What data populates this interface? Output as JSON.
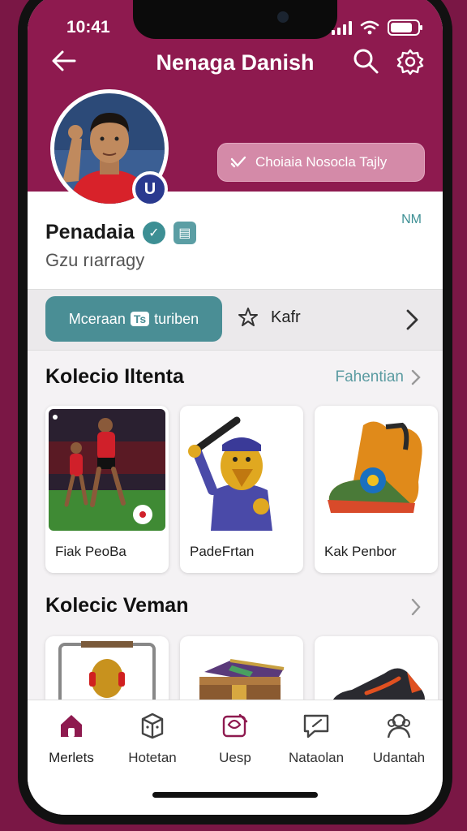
{
  "status": {
    "time": "10:41"
  },
  "header": {
    "title": "Nenaga Danish",
    "action_button": "Choiaia Nosocla Tajly"
  },
  "profile": {
    "name": "Penadaia",
    "subtitle": "Gzu rıarragy",
    "corner_tag": "NM"
  },
  "tabs": {
    "active_left": "Mceraan",
    "active_chip": "Ts",
    "active_right": "turiben",
    "second": "Kafr"
  },
  "section1": {
    "title": "Kolecio Iltenta",
    "link": "Fahentian",
    "items": [
      {
        "label": "Fiak PeoBa"
      },
      {
        "label": "PadeFrtan"
      },
      {
        "label": "Kak Penbor"
      }
    ]
  },
  "section2": {
    "title": "Kolecic Veman"
  },
  "nav": [
    {
      "label": "Merlets",
      "icon": "home-icon"
    },
    {
      "label": "Hotetan",
      "icon": "box-icon"
    },
    {
      "label": "Uesp",
      "icon": "gift-icon"
    },
    {
      "label": "Nataolan",
      "icon": "chat-icon"
    },
    {
      "label": "Udantah",
      "icon": "people-icon"
    }
  ],
  "colors": {
    "header": "#8e1a4f",
    "accent": "#4a8e95",
    "pill": "#d48aa8",
    "background": "#7a1745"
  }
}
